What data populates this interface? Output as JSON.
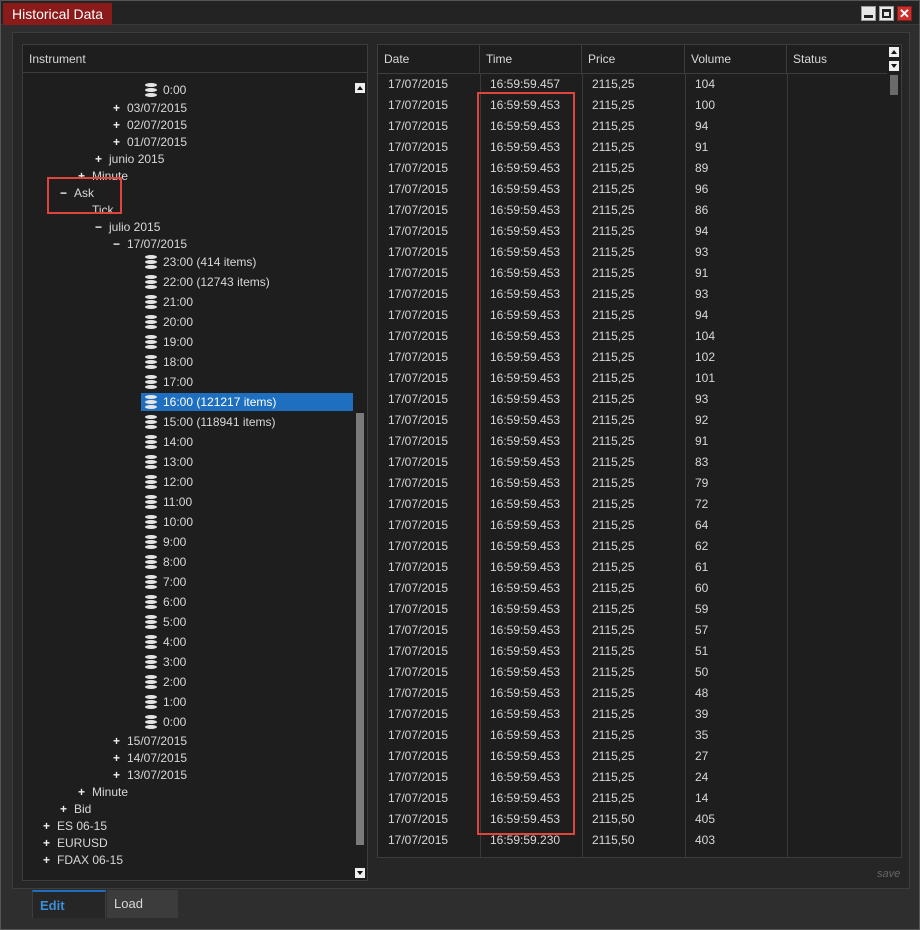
{
  "window": {
    "title": "Historical Data"
  },
  "tree": {
    "header": "Instrument",
    "nodes": [
      {
        "label": "0:00",
        "level": 5,
        "icon": "db",
        "exp": ""
      },
      {
        "label": "03/07/2015",
        "level": 4,
        "exp": "+"
      },
      {
        "label": "02/07/2015",
        "level": 4,
        "exp": "+"
      },
      {
        "label": "01/07/2015",
        "level": 4,
        "exp": "+"
      },
      {
        "label": "junio 2015",
        "level": 3,
        "exp": "+"
      },
      {
        "label": "Minute",
        "level": 2,
        "exp": "+"
      },
      {
        "label": "Ask",
        "level": 1,
        "exp": "−"
      },
      {
        "label": "Tick",
        "level": 2,
        "exp": ""
      },
      {
        "label": "julio 2015",
        "level": 3,
        "exp": "−"
      },
      {
        "label": "17/07/2015",
        "level": 4,
        "exp": "−"
      },
      {
        "label": "23:00 (414 items)",
        "level": 5,
        "icon": "db"
      },
      {
        "label": "22:00 (12743 items)",
        "level": 5,
        "icon": "db"
      },
      {
        "label": "21:00",
        "level": 5,
        "icon": "db"
      },
      {
        "label": "20:00",
        "level": 5,
        "icon": "db"
      },
      {
        "label": "19:00",
        "level": 5,
        "icon": "db"
      },
      {
        "label": "18:00",
        "level": 5,
        "icon": "db"
      },
      {
        "label": "17:00",
        "level": 5,
        "icon": "db"
      },
      {
        "label": "16:00 (121217 items)",
        "level": 5,
        "icon": "db",
        "selected": true
      },
      {
        "label": "15:00 (118941 items)",
        "level": 5,
        "icon": "db"
      },
      {
        "label": "14:00",
        "level": 5,
        "icon": "db"
      },
      {
        "label": "13:00",
        "level": 5,
        "icon": "db"
      },
      {
        "label": "12:00",
        "level": 5,
        "icon": "db"
      },
      {
        "label": "11:00",
        "level": 5,
        "icon": "db"
      },
      {
        "label": "10:00",
        "level": 5,
        "icon": "db"
      },
      {
        "label": "9:00",
        "level": 5,
        "icon": "db"
      },
      {
        "label": "8:00",
        "level": 5,
        "icon": "db"
      },
      {
        "label": "7:00",
        "level": 5,
        "icon": "db"
      },
      {
        "label": "6:00",
        "level": 5,
        "icon": "db"
      },
      {
        "label": "5:00",
        "level": 5,
        "icon": "db"
      },
      {
        "label": "4:00",
        "level": 5,
        "icon": "db"
      },
      {
        "label": "3:00",
        "level": 5,
        "icon": "db"
      },
      {
        "label": "2:00",
        "level": 5,
        "icon": "db"
      },
      {
        "label": "1:00",
        "level": 5,
        "icon": "db"
      },
      {
        "label": "0:00",
        "level": 5,
        "icon": "db"
      },
      {
        "label": "15/07/2015",
        "level": 4,
        "exp": "+"
      },
      {
        "label": "14/07/2015",
        "level": 4,
        "exp": "+"
      },
      {
        "label": "13/07/2015",
        "level": 4,
        "exp": "+"
      },
      {
        "label": "Minute",
        "level": 2,
        "exp": "+"
      },
      {
        "label": "Bid",
        "level": 1,
        "exp": "+"
      },
      {
        "label": "ES 06-15",
        "level": 0,
        "exp": "+"
      },
      {
        "label": "EURUSD",
        "level": 0,
        "exp": "+"
      },
      {
        "label": "FDAX 06-15",
        "level": 0,
        "exp": "+"
      }
    ]
  },
  "grid": {
    "columns": [
      "Date",
      "Time",
      "Price",
      "Volume",
      "Status"
    ],
    "rows": [
      [
        "17/07/2015",
        "16:59:59.457",
        "2115,25",
        "104",
        ""
      ],
      [
        "17/07/2015",
        "16:59:59.453",
        "2115,25",
        "100",
        ""
      ],
      [
        "17/07/2015",
        "16:59:59.453",
        "2115,25",
        "94",
        ""
      ],
      [
        "17/07/2015",
        "16:59:59.453",
        "2115,25",
        "91",
        ""
      ],
      [
        "17/07/2015",
        "16:59:59.453",
        "2115,25",
        "89",
        ""
      ],
      [
        "17/07/2015",
        "16:59:59.453",
        "2115,25",
        "96",
        ""
      ],
      [
        "17/07/2015",
        "16:59:59.453",
        "2115,25",
        "86",
        ""
      ],
      [
        "17/07/2015",
        "16:59:59.453",
        "2115,25",
        "94",
        ""
      ],
      [
        "17/07/2015",
        "16:59:59.453",
        "2115,25",
        "93",
        ""
      ],
      [
        "17/07/2015",
        "16:59:59.453",
        "2115,25",
        "91",
        ""
      ],
      [
        "17/07/2015",
        "16:59:59.453",
        "2115,25",
        "93",
        ""
      ],
      [
        "17/07/2015",
        "16:59:59.453",
        "2115,25",
        "94",
        ""
      ],
      [
        "17/07/2015",
        "16:59:59.453",
        "2115,25",
        "104",
        ""
      ],
      [
        "17/07/2015",
        "16:59:59.453",
        "2115,25",
        "102",
        ""
      ],
      [
        "17/07/2015",
        "16:59:59.453",
        "2115,25",
        "101",
        ""
      ],
      [
        "17/07/2015",
        "16:59:59.453",
        "2115,25",
        "93",
        ""
      ],
      [
        "17/07/2015",
        "16:59:59.453",
        "2115,25",
        "92",
        ""
      ],
      [
        "17/07/2015",
        "16:59:59.453",
        "2115,25",
        "91",
        ""
      ],
      [
        "17/07/2015",
        "16:59:59.453",
        "2115,25",
        "83",
        ""
      ],
      [
        "17/07/2015",
        "16:59:59.453",
        "2115,25",
        "79",
        ""
      ],
      [
        "17/07/2015",
        "16:59:59.453",
        "2115,25",
        "72",
        ""
      ],
      [
        "17/07/2015",
        "16:59:59.453",
        "2115,25",
        "64",
        ""
      ],
      [
        "17/07/2015",
        "16:59:59.453",
        "2115,25",
        "62",
        ""
      ],
      [
        "17/07/2015",
        "16:59:59.453",
        "2115,25",
        "61",
        ""
      ],
      [
        "17/07/2015",
        "16:59:59.453",
        "2115,25",
        "60",
        ""
      ],
      [
        "17/07/2015",
        "16:59:59.453",
        "2115,25",
        "59",
        ""
      ],
      [
        "17/07/2015",
        "16:59:59.453",
        "2115,25",
        "57",
        ""
      ],
      [
        "17/07/2015",
        "16:59:59.453",
        "2115,25",
        "51",
        ""
      ],
      [
        "17/07/2015",
        "16:59:59.453",
        "2115,25",
        "50",
        ""
      ],
      [
        "17/07/2015",
        "16:59:59.453",
        "2115,25",
        "48",
        ""
      ],
      [
        "17/07/2015",
        "16:59:59.453",
        "2115,25",
        "39",
        ""
      ],
      [
        "17/07/2015",
        "16:59:59.453",
        "2115,25",
        "35",
        ""
      ],
      [
        "17/07/2015",
        "16:59:59.453",
        "2115,25",
        "27",
        ""
      ],
      [
        "17/07/2015",
        "16:59:59.453",
        "2115,25",
        "24",
        ""
      ],
      [
        "17/07/2015",
        "16:59:59.453",
        "2115,25",
        "14",
        ""
      ],
      [
        "17/07/2015",
        "16:59:59.453",
        "2115,50",
        "405",
        ""
      ],
      [
        "17/07/2015",
        "16:59:59.230",
        "2115,50",
        "403",
        ""
      ]
    ],
    "save_label": "save"
  },
  "tabs": {
    "edit": "Edit",
    "load": "Load"
  },
  "colors": {
    "title_tab": "#8b1a1a",
    "selection": "#1e6fbf",
    "highlight_box": "#e0443c"
  }
}
